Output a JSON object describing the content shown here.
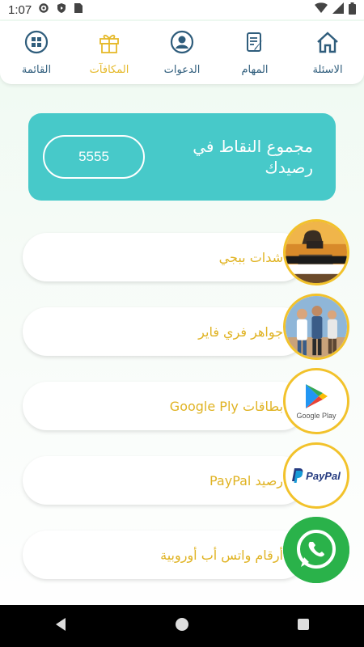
{
  "status_bar": {
    "time": "1:07"
  },
  "tabs": [
    {
      "label": "القائمة",
      "icon": "grid-icon",
      "active": false
    },
    {
      "label": "المكافآت",
      "icon": "gift-icon",
      "active": true
    },
    {
      "label": "الدعوات",
      "icon": "user-circle-icon",
      "active": false
    },
    {
      "label": "المهام",
      "icon": "tasks-icon",
      "active": false
    },
    {
      "label": "الاسئلة",
      "icon": "home-icon",
      "active": false
    }
  ],
  "points": {
    "label": "مجموع النقاط في رصيدك",
    "value": "5555"
  },
  "rewards": [
    {
      "label": "شدات ببجي",
      "image": "pubg-battlegrounds-logo"
    },
    {
      "label": "جواهر فري فاير",
      "image": "free-fire-characters"
    },
    {
      "label": "بطاقات Google Ply",
      "image": "google-play-logo",
      "logo_text": "Google Play"
    },
    {
      "label": "رصيد PayPal",
      "image": "paypal-logo",
      "logo_text": "PayPal"
    },
    {
      "label": "أرقام واتس أب أوروبية",
      "image": "whatsapp-logo"
    }
  ],
  "colors": {
    "accent": "#47c9c9",
    "gold": "#e0b323",
    "tab_text": "#2f5d7c"
  }
}
